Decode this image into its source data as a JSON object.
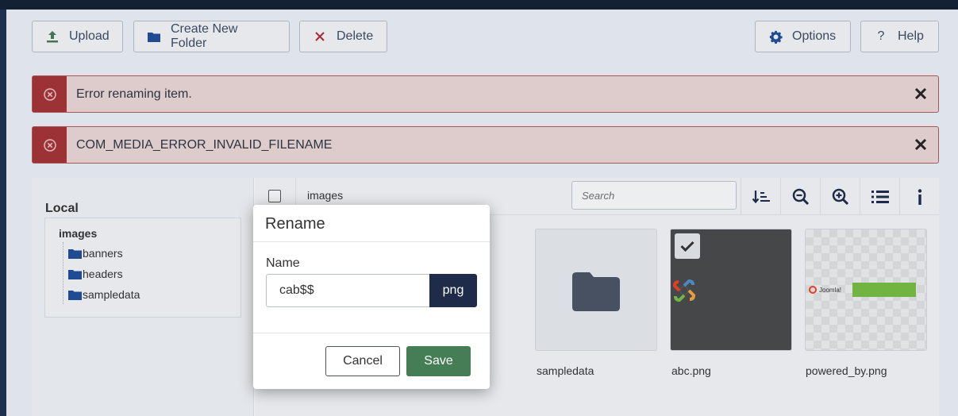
{
  "toolbar": {
    "upload_label": "Upload",
    "new_folder_label": "Create New Folder",
    "delete_label": "Delete",
    "options_label": "Options",
    "help_label": "Help"
  },
  "alerts": [
    {
      "message": "Error renaming item."
    },
    {
      "message": "COM_MEDIA_ERROR_INVALID_FILENAME"
    }
  ],
  "sidebar": {
    "title": "Local",
    "root": "images",
    "items": [
      {
        "label": "banners"
      },
      {
        "label": "headers"
      },
      {
        "label": "sampledata"
      }
    ]
  },
  "browser": {
    "breadcrumb": "images",
    "search_placeholder": "Search",
    "items": [
      {
        "label": "sampledata"
      },
      {
        "label": "abc.png"
      },
      {
        "label": "powered_by.png"
      }
    ]
  },
  "modal": {
    "title": "Rename",
    "name_label": "Name",
    "name_value": "cab$$",
    "extension": "png",
    "cancel_label": "Cancel",
    "save_label": "Save"
  },
  "colors": {
    "accent_dark": "#1e2c4a",
    "save_green": "#457d54",
    "error_red": "#a93337"
  }
}
